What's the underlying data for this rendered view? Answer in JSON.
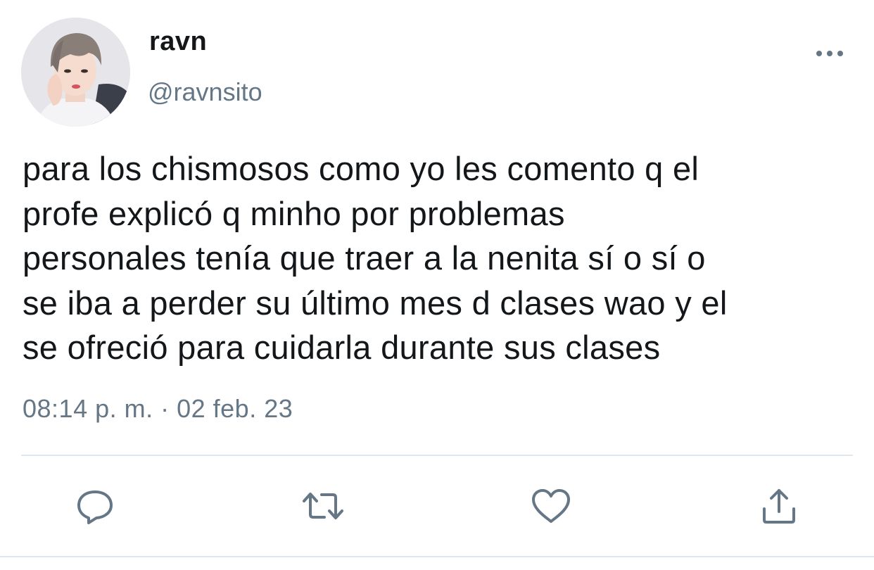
{
  "tweet": {
    "display_name": "ravn",
    "handle": "@ravnsito",
    "text": "para los chismosos como yo les comento q el\nprofe explicó q minho por problemas\npersonales tenía que traer a la nenita sí o sí o\nse iba a perder su último mes d clases wao y el\nse ofreció para cuidarla durante sus clases",
    "timestamp": "08:14 p. m. · 02 feb. 23"
  },
  "icons": {
    "more": "more-options-icon",
    "reply": "reply-icon",
    "retweet": "retweet-icon",
    "like": "like-icon",
    "share": "share-icon"
  },
  "colors": {
    "text": "#14171a",
    "secondary": "#657786",
    "divider": "#e1e8ed"
  }
}
